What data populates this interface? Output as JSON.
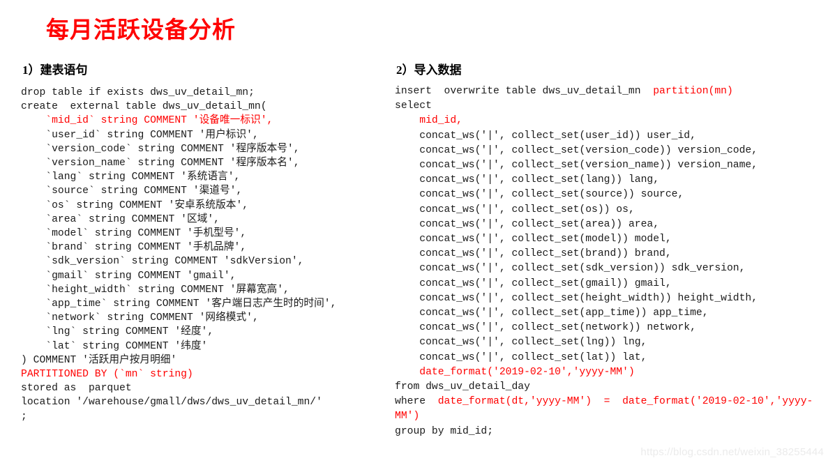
{
  "slide": {
    "title": "每月活跃设备分析",
    "title_color": "#ff0000",
    "background_color": "#ffffff",
    "code_color": "#1a1a1a"
  },
  "left_section": {
    "heading": "1）建表语句",
    "lines": [
      {
        "text": "drop table if exists dws_uv_detail_mn;",
        "color": "black"
      },
      {
        "text": "create  external table dws_uv_detail_mn(",
        "color": "black"
      },
      {
        "text": "    `mid_id` string COMMENT '设备唯一标识',",
        "color": "red"
      },
      {
        "text": "    `user_id` string COMMENT '用户标识',",
        "color": "black"
      },
      {
        "text": "    `version_code` string COMMENT '程序版本号',",
        "color": "black"
      },
      {
        "text": "    `version_name` string COMMENT '程序版本名',",
        "color": "black"
      },
      {
        "text": "    `lang` string COMMENT '系统语言',",
        "color": "black"
      },
      {
        "text": "    `source` string COMMENT '渠道号',",
        "color": "black"
      },
      {
        "text": "    `os` string COMMENT '安卓系统版本',",
        "color": "black"
      },
      {
        "text": "    `area` string COMMENT '区域',",
        "color": "black"
      },
      {
        "text": "    `model` string COMMENT '手机型号',",
        "color": "black"
      },
      {
        "text": "    `brand` string COMMENT '手机品牌',",
        "color": "black"
      },
      {
        "text": "    `sdk_version` string COMMENT 'sdkVersion',",
        "color": "black"
      },
      {
        "text": "    `gmail` string COMMENT 'gmail',",
        "color": "black"
      },
      {
        "text": "    `height_width` string COMMENT '屏幕宽高',",
        "color": "black"
      },
      {
        "text": "    `app_time` string COMMENT '客户端日志产生时的时间',",
        "color": "black"
      },
      {
        "text": "    `network` string COMMENT '网络模式',",
        "color": "black"
      },
      {
        "text": "    `lng` string COMMENT '经度',",
        "color": "black"
      },
      {
        "text": "    `lat` string COMMENT '纬度'",
        "color": "black"
      },
      {
        "text": ") COMMENT '活跃用户按月明细'",
        "color": "black"
      },
      {
        "text": "PARTITIONED BY (`mn` string)",
        "color": "red"
      },
      {
        "text": "stored as  parquet",
        "color": "black"
      },
      {
        "text": "location '/warehouse/gmall/dws/dws_uv_detail_mn/'",
        "color": "black"
      },
      {
        "text": ";",
        "color": "black"
      }
    ]
  },
  "right_section": {
    "heading": "2）导入数据",
    "lines": [
      {
        "segments": [
          {
            "t": "insert  overwrite table dws_uv_detail_mn  ",
            "c": "black"
          },
          {
            "t": "partition(mn)",
            "c": "red"
          }
        ]
      },
      {
        "segments": [
          {
            "t": "select",
            "c": "black"
          }
        ]
      },
      {
        "segments": [
          {
            "t": "    mid_id,",
            "c": "red"
          }
        ]
      },
      {
        "segments": [
          {
            "t": "    concat_ws('|', collect_set(user_id)) user_id,",
            "c": "black"
          }
        ]
      },
      {
        "segments": [
          {
            "t": "    concat_ws('|', collect_set(version_code)) version_code,",
            "c": "black"
          }
        ]
      },
      {
        "segments": [
          {
            "t": "    concat_ws('|', collect_set(version_name)) version_name,",
            "c": "black"
          }
        ]
      },
      {
        "segments": [
          {
            "t": "    concat_ws('|', collect_set(lang)) lang,",
            "c": "black"
          }
        ]
      },
      {
        "segments": [
          {
            "t": "    concat_ws('|', collect_set(source)) source,",
            "c": "black"
          }
        ]
      },
      {
        "segments": [
          {
            "t": "    concat_ws('|', collect_set(os)) os,",
            "c": "black"
          }
        ]
      },
      {
        "segments": [
          {
            "t": "    concat_ws('|', collect_set(area)) area,",
            "c": "black"
          }
        ]
      },
      {
        "segments": [
          {
            "t": "    concat_ws('|', collect_set(model)) model,",
            "c": "black"
          }
        ]
      },
      {
        "segments": [
          {
            "t": "    concat_ws('|', collect_set(brand)) brand,",
            "c": "black"
          }
        ]
      },
      {
        "segments": [
          {
            "t": "    concat_ws('|', collect_set(sdk_version)) sdk_version,",
            "c": "black"
          }
        ]
      },
      {
        "segments": [
          {
            "t": "    concat_ws('|', collect_set(gmail)) gmail,",
            "c": "black"
          }
        ]
      },
      {
        "segments": [
          {
            "t": "    concat_ws('|', collect_set(height_width)) height_width,",
            "c": "black"
          }
        ]
      },
      {
        "segments": [
          {
            "t": "    concat_ws('|', collect_set(app_time)) app_time,",
            "c": "black"
          }
        ]
      },
      {
        "segments": [
          {
            "t": "    concat_ws('|', collect_set(network)) network,",
            "c": "black"
          }
        ]
      },
      {
        "segments": [
          {
            "t": "    concat_ws('|', collect_set(lng)) lng,",
            "c": "black"
          }
        ]
      },
      {
        "segments": [
          {
            "t": "    concat_ws('|', collect_set(lat)) lat,",
            "c": "black"
          }
        ]
      },
      {
        "segments": [
          {
            "t": "    date_format('2019-02-10','yyyy-MM')",
            "c": "red"
          }
        ]
      },
      {
        "segments": [
          {
            "t": "from dws_uv_detail_day",
            "c": "black"
          }
        ]
      },
      {
        "segments": [
          {
            "t": "where  ",
            "c": "black"
          },
          {
            "t": "date_format(dt,'yyyy-MM')  =  date_format('2019-02-10','yyyy-MM')",
            "c": "red"
          }
        ]
      },
      {
        "segments": [
          {
            "t": "group by mid_id;",
            "c": "black"
          }
        ]
      }
    ]
  },
  "watermark": {
    "text": "https://blog.csdn.net/weixin_38255444"
  }
}
